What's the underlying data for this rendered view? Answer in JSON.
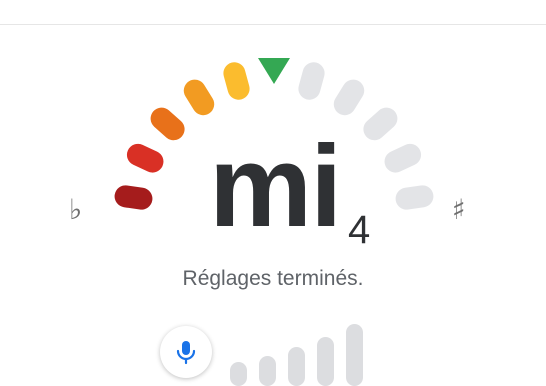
{
  "tuner": {
    "note": "mi",
    "octave": "4",
    "flat_symbol": "♭",
    "sharp_symbol": "♯",
    "status": "Réglages terminés.",
    "colors": {
      "needle": "#34a853",
      "inactive_segment": "#e3e4e7",
      "active_segments": [
        "#a51c1c",
        "#d93025",
        "#e8711a",
        "#f29b22",
        "#fbbc2e"
      ]
    },
    "active_segment_count": 5,
    "total_segment_count": 10
  },
  "microphone": {
    "icon": "mic-icon",
    "accent_color": "#1a73e8",
    "input_levels": [
      0.1,
      0.25,
      0.45,
      0.7,
      1.0
    ]
  }
}
